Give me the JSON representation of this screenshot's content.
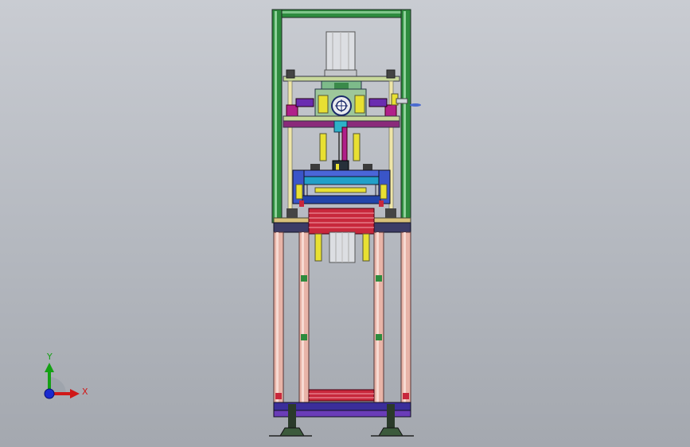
{
  "viewport": {
    "background_top": "#c9ccd2",
    "background_bottom": "#a4a8af"
  },
  "model": {
    "description_icon": "cad-assembly-press-machine-icon",
    "colors": {
      "frame_green": "#2e8b3e",
      "frame_dark": "#1d2b22",
      "plate_lime": "#c8d89a",
      "leg_pink": "#e8b4a8",
      "cylinder_gray": "#d6d8dc",
      "magenta": "#b0208a",
      "yellow": "#e8e032",
      "blue": "#2244aa",
      "purple": "#6a2cb0",
      "red_plate": "#c8283c",
      "teal": "#3ea8a0"
    }
  },
  "triad": {
    "y_label": "Y",
    "x_label": "X",
    "y_color": "#14a014",
    "x_color": "#d01818",
    "origin_color": "#1a2ad0"
  }
}
